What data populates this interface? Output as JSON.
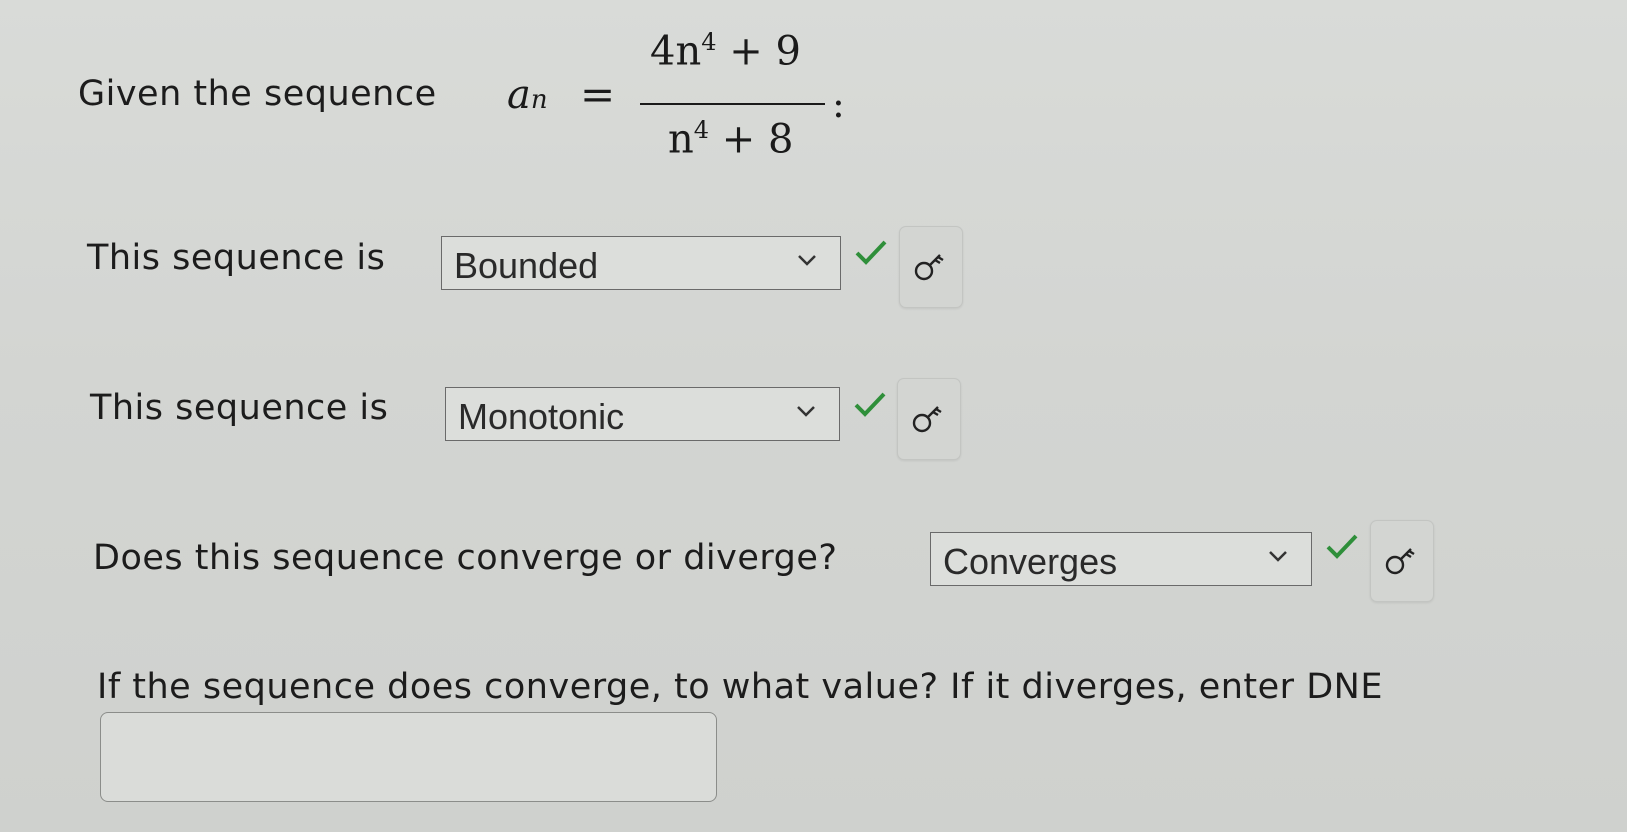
{
  "problem": {
    "intro": "Given the sequence",
    "var_a": "a",
    "var_n": "n",
    "equals": "=",
    "numerator_main": "4n",
    "numerator_exp": "4",
    "numerator_rest": " + 9",
    "denominator_main": "n",
    "denominator_exp": "4",
    "denominator_rest": " + 8",
    "colon": ":"
  },
  "questions": [
    {
      "prompt": "This sequence is",
      "selected": "Bounded",
      "status": "correct"
    },
    {
      "prompt": "This sequence is",
      "selected": "Monotonic",
      "status": "correct"
    },
    {
      "prompt": "Does this sequence converge or diverge?",
      "selected": "Converges",
      "status": "correct"
    }
  ],
  "final_question": {
    "prompt": "If the sequence does converge, to what value? If it diverges, enter DNE",
    "value": "",
    "placeholder": ""
  },
  "icons": {
    "dropdown": "chevron-down-icon",
    "status": "checkmark-icon",
    "key": "key-icon"
  },
  "colors": {
    "check": "#2f8f3a",
    "background": "#d6d8d5"
  }
}
